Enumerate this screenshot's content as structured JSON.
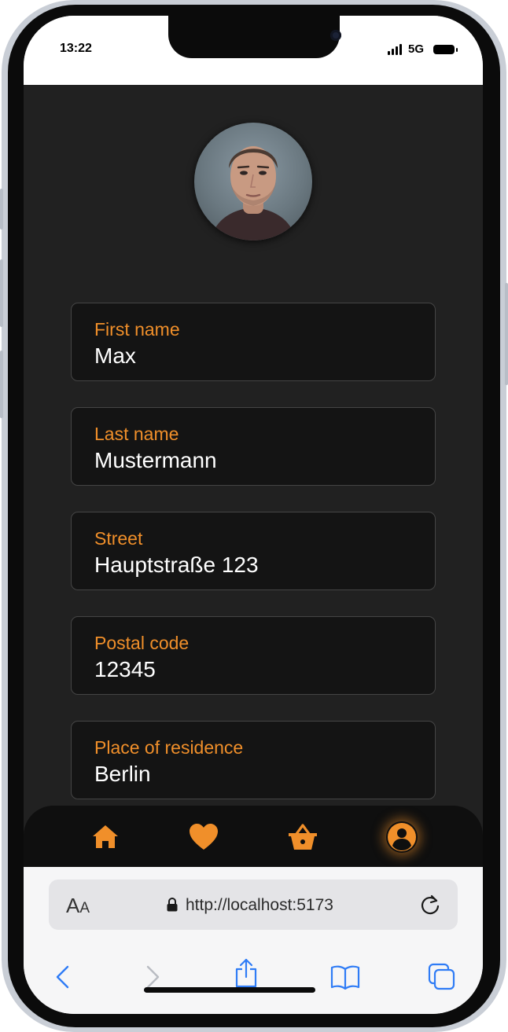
{
  "status_bar": {
    "time": "13:22",
    "network": "5G"
  },
  "profile": {
    "avatar_icon": "user-portrait",
    "fields": [
      {
        "label": "First name",
        "value": "Max"
      },
      {
        "label": "Last name",
        "value": "Mustermann"
      },
      {
        "label": "Street",
        "value": "Hauptstraße 123"
      },
      {
        "label": "Postal code",
        "value": "12345"
      },
      {
        "label": "Place of residence",
        "value": "Berlin"
      }
    ]
  },
  "bottom_nav": {
    "items": [
      {
        "icon": "home-icon",
        "active": false
      },
      {
        "icon": "heart-icon",
        "active": false
      },
      {
        "icon": "basket-icon",
        "active": false
      },
      {
        "icon": "profile-icon",
        "active": true
      }
    ]
  },
  "browser": {
    "text_size_label": "AA",
    "url": "http://localhost:5173",
    "toolbar_icons": [
      "back-icon",
      "forward-icon",
      "share-icon",
      "bookmarks-icon",
      "tabs-icon"
    ]
  },
  "colors": {
    "accent": "#f08f2a",
    "app_background": "#212121",
    "field_background": "#141414",
    "browser_link": "#2f7cf6"
  }
}
